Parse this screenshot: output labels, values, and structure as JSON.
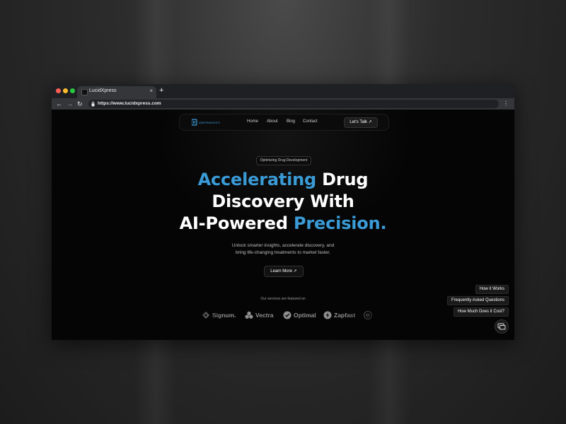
{
  "browser": {
    "tab_title": "LucidXpress",
    "tab_close": "×",
    "new_tab": "+",
    "url": "https://www.lucidxpress.com",
    "back": "←",
    "forward": "→",
    "reload": "↻",
    "menu": "⋮"
  },
  "nav": {
    "logo_text": "DEEPINSIGHTS",
    "links": [
      "Home",
      "About",
      "Blog",
      "Contact"
    ],
    "cta_label": "Let's Talk ↗"
  },
  "hero": {
    "badge": "Optimizing Drug Development",
    "line1_accent": "Accelerating",
    "line1_rest": "Drug",
    "line2": "Discovery With",
    "line3_start": "AI-Powered",
    "line3_accent": "Precision.",
    "sub_line1": "Unlock smarter insights, accelerate discovery, and",
    "sub_line2": "bring life-changing treatments to market faster.",
    "button": "Learn More ➚"
  },
  "partners": {
    "caption": "Our services are featured on",
    "brands": [
      "Signum.",
      "Vectra",
      "Optimal",
      "Zapfast"
    ]
  },
  "faq_chips": [
    "How it Works",
    "Frequently Asked Questions",
    "How Much Does it Cost?"
  ],
  "colors": {
    "accent": "#3a9bd6",
    "page_bg": "#050505",
    "chrome": "#35363a"
  }
}
